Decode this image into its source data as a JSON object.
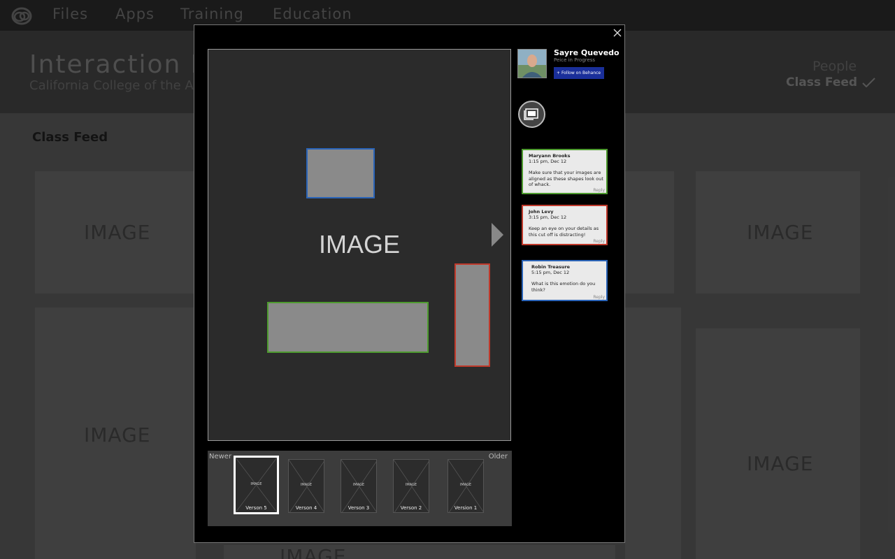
{
  "nav": {
    "items": [
      "Files",
      "Apps",
      "Training",
      "Education"
    ]
  },
  "header": {
    "title": "Interaction II",
    "subtitle": "California College of the Arts",
    "people_label": "People",
    "class_feed_label": "Class Feed",
    "check_icon": "checkmark-icon"
  },
  "section": {
    "title": "Class Feed"
  },
  "background_cards": {
    "label": "IMAGE"
  },
  "modal": {
    "main_image_label": "IMAGE",
    "highlights": [
      {
        "color": "#2a64b8",
        "comment": "Robin Treasure"
      },
      {
        "color": "#4e9b2f",
        "comment": "Maryann Brooks"
      },
      {
        "color": "#c0392b",
        "comment": "John Levy"
      }
    ],
    "versions": {
      "newer_label": "Newer",
      "older_label": "Older",
      "selected": "Verson 5",
      "items": [
        {
          "label": "Verson 5",
          "image": "IMAGE"
        },
        {
          "label": "Verson 4",
          "image": "IMAGE"
        },
        {
          "label": "Verson 3",
          "image": "IMAGE"
        },
        {
          "label": "Verson 2",
          "image": "IMAGE"
        },
        {
          "label": "Version 1",
          "image": "IMAGE"
        }
      ]
    },
    "user": {
      "name": "Sayre Quevedo",
      "status": "Peice in Progress",
      "follow_label": "Follow on Behance"
    },
    "comments": [
      {
        "name": "Maryann Brooks",
        "time": "1:15 pm, Dec 12",
        "text": "Make sure that your images are aligned as these shapes look out of whack.",
        "reply": "Reply",
        "color": "#4e9b2f"
      },
      {
        "name": "John Levy",
        "time": "3:15 pm, Dec 12",
        "text": "Keep an eye on your details as this cut off is distracting!",
        "reply": "Reply",
        "color": "#c0392b"
      },
      {
        "name": "Robin Treasure",
        "time": "5:15 pm, Dec 12",
        "text": "What is this emotion do you think?",
        "reply": "Reply",
        "color": "#2a64b8"
      }
    ]
  }
}
